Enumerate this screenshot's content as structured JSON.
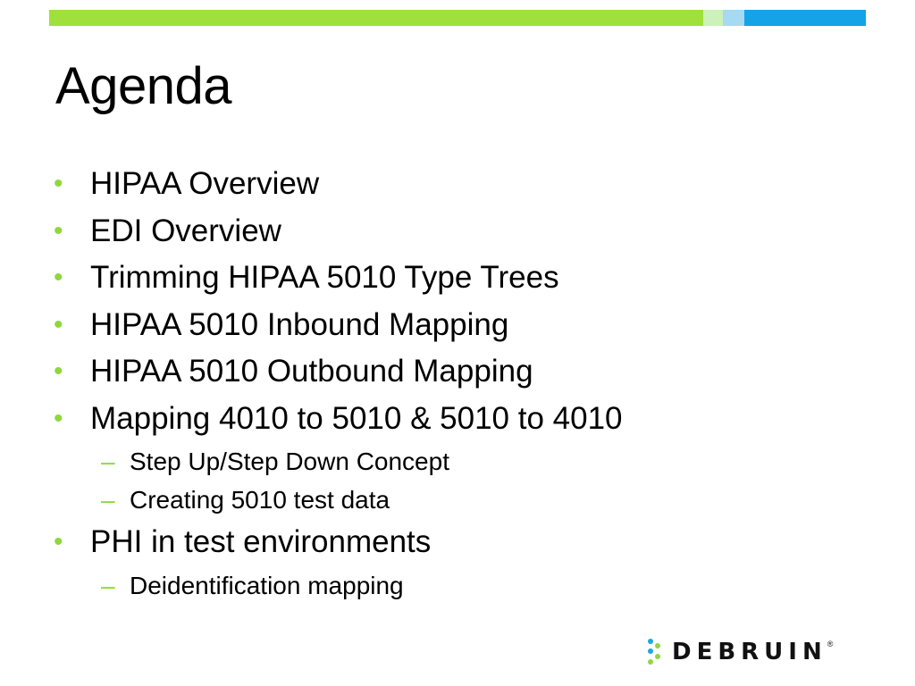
{
  "slide": {
    "title": "Agenda",
    "bullets": [
      {
        "text": "HIPAA Overview"
      },
      {
        "text": "EDI Overview"
      },
      {
        "text": "Trimming HIPAA 5010 Type Trees"
      },
      {
        "text": "HIPAA 5010 Inbound Mapping"
      },
      {
        "text": "HIPAA 5010 Outbound Mapping"
      },
      {
        "text": "Mapping 4010 to 5010 & 5010 to 4010",
        "subitems": [
          "Step Up/Step Down Concept",
          "Creating 5010 test data"
        ]
      },
      {
        "text": "PHI in test environments",
        "subitems": [
          "Deidentification mapping"
        ]
      }
    ],
    "bullet_glyph": "•",
    "sub_glyph": "–"
  },
  "logo": {
    "text": "DEBRUIN",
    "registered": "®",
    "icon": "debruin-logo-icon"
  },
  "colors": {
    "accent_green": "#8ed83c",
    "bar_green": "#9fe03a",
    "bar_light_green": "#ccf1b9",
    "bar_light_blue": "#a5daf2",
    "bar_blue": "#14a3e6",
    "logo_mark_blue": "#1aa7e8",
    "logo_mark_green": "#8ed83c"
  }
}
